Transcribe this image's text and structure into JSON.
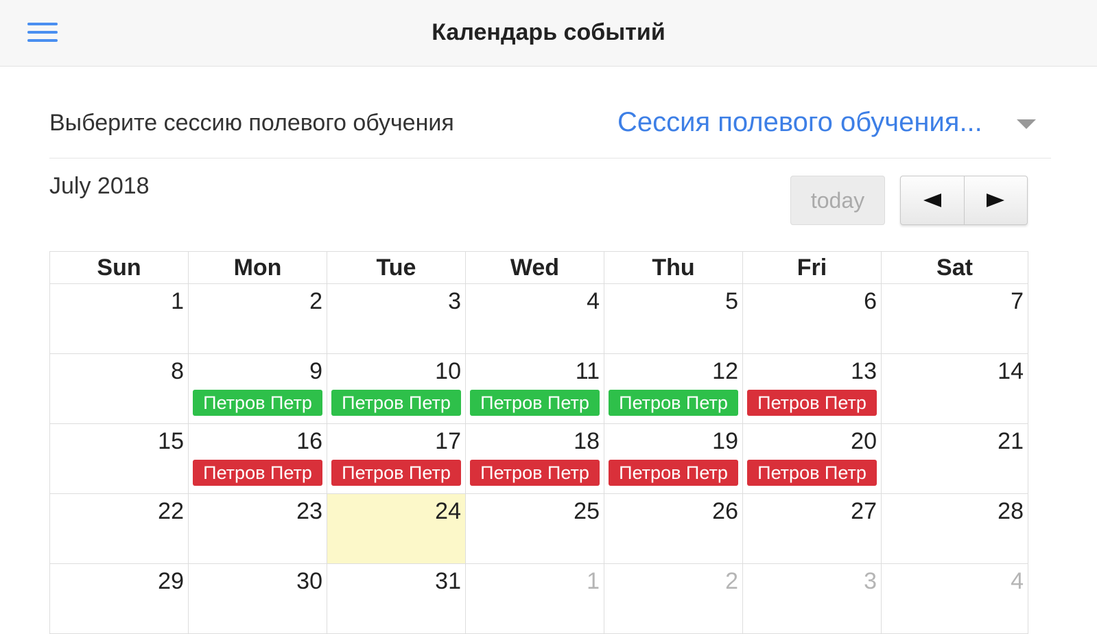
{
  "header": {
    "title": "Календарь событий",
    "menu_icon": "hamburger-menu-icon"
  },
  "session": {
    "label": "Выберите сессию полевого обучения",
    "selected": "Сессия полевого обучения...",
    "arrow_icon": "dropdown-arrow-icon"
  },
  "calendar": {
    "month_title": "July 2018",
    "today_label": "today",
    "prev_icon": "prev-arrow-icon",
    "next_icon": "next-arrow-icon",
    "weekdays": [
      "Sun",
      "Mon",
      "Tue",
      "Wed",
      "Thu",
      "Fri",
      "Sat"
    ],
    "weeks": [
      [
        {
          "day": "1"
        },
        {
          "day": "2"
        },
        {
          "day": "3"
        },
        {
          "day": "4"
        },
        {
          "day": "5"
        },
        {
          "day": "6"
        },
        {
          "day": "7"
        }
      ],
      [
        {
          "day": "8"
        },
        {
          "day": "9",
          "event": "Петров Петр",
          "event_color": "green"
        },
        {
          "day": "10",
          "event": "Петров Петр",
          "event_color": "green"
        },
        {
          "day": "11",
          "event": "Петров Петр",
          "event_color": "green"
        },
        {
          "day": "12",
          "event": "Петров Петр",
          "event_color": "green"
        },
        {
          "day": "13",
          "event": "Петров Петр",
          "event_color": "red"
        },
        {
          "day": "14"
        }
      ],
      [
        {
          "day": "15"
        },
        {
          "day": "16",
          "event": "Петров Петр",
          "event_color": "red"
        },
        {
          "day": "17",
          "event": "Петров Петр",
          "event_color": "red"
        },
        {
          "day": "18",
          "event": "Петров Петр",
          "event_color": "red"
        },
        {
          "day": "19",
          "event": "Петров Петр",
          "event_color": "red"
        },
        {
          "day": "20",
          "event": "Петров Петр",
          "event_color": "red"
        },
        {
          "day": "21"
        }
      ],
      [
        {
          "day": "22"
        },
        {
          "day": "23"
        },
        {
          "day": "24",
          "today": true
        },
        {
          "day": "25"
        },
        {
          "day": "26"
        },
        {
          "day": "27"
        },
        {
          "day": "28"
        }
      ],
      [
        {
          "day": "29"
        },
        {
          "day": "30"
        },
        {
          "day": "31"
        },
        {
          "day": "1",
          "other_month": true
        },
        {
          "day": "2",
          "other_month": true
        },
        {
          "day": "3",
          "other_month": true
        },
        {
          "day": "4",
          "other_month": true
        }
      ]
    ]
  },
  "colors": {
    "accent": "#3d7fe6",
    "event_green": "#2ec04a",
    "event_red": "#d9303a",
    "today_highlight": "#fcf8c9"
  }
}
